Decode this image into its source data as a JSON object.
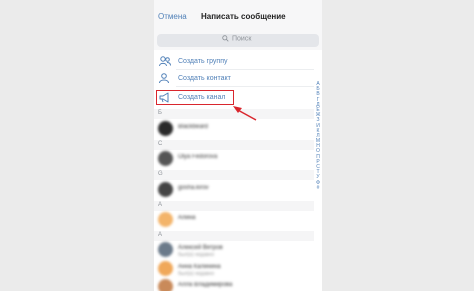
{
  "header": {
    "cancel_label": "Отмена",
    "title": "Написать сообщение"
  },
  "search": {
    "placeholder": "Поиск",
    "icon": "search-icon"
  },
  "actions": [
    {
      "label": "Создать группу",
      "icon": "group-icon"
    },
    {
      "label": "Создать контакт",
      "icon": "add-contact-icon"
    },
    {
      "label": "Создать канал",
      "icon": "megaphone-icon"
    }
  ],
  "sections": [
    {
      "letter": "Б",
      "contacts": [
        {
          "name": "Blackbeard",
          "status": "",
          "color": "#2a2a2a"
        }
      ]
    },
    {
      "letter": "C",
      "contacts": [
        {
          "name": "Olya Fedorova",
          "status": "",
          "color": "#555555"
        }
      ]
    },
    {
      "letter": "G",
      "contacts": [
        {
          "name": "gosha.kirov",
          "status": "",
          "color": "#444444"
        }
      ]
    },
    {
      "letter": "A",
      "contacts": [
        {
          "name": "Алина",
          "status": "",
          "color": "#f3b46a"
        }
      ]
    },
    {
      "letter": "А",
      "contacts": [
        {
          "name": "Алексей Ветров",
          "status": "был(а) недавно",
          "color": "#6b7a8a"
        },
        {
          "name": "Анна Калинина",
          "status": "был(а) недавно",
          "color": "#f0a85a"
        },
        {
          "name": "Алла Владимирова",
          "status": "был(а) недавно",
          "color": "#c98a5a"
        }
      ]
    }
  ],
  "index_letters": [
    "A",
    "Б",
    "В",
    "Г",
    "Д",
    "Е",
    "Ж",
    "З",
    "И",
    "К",
    "Л",
    "М",
    "Н",
    "О",
    "П",
    "Р",
    "С",
    "Т",
    "У",
    "Ф",
    "#"
  ],
  "colors": {
    "accent": "#5181b8",
    "highlight": "#d9262d"
  }
}
